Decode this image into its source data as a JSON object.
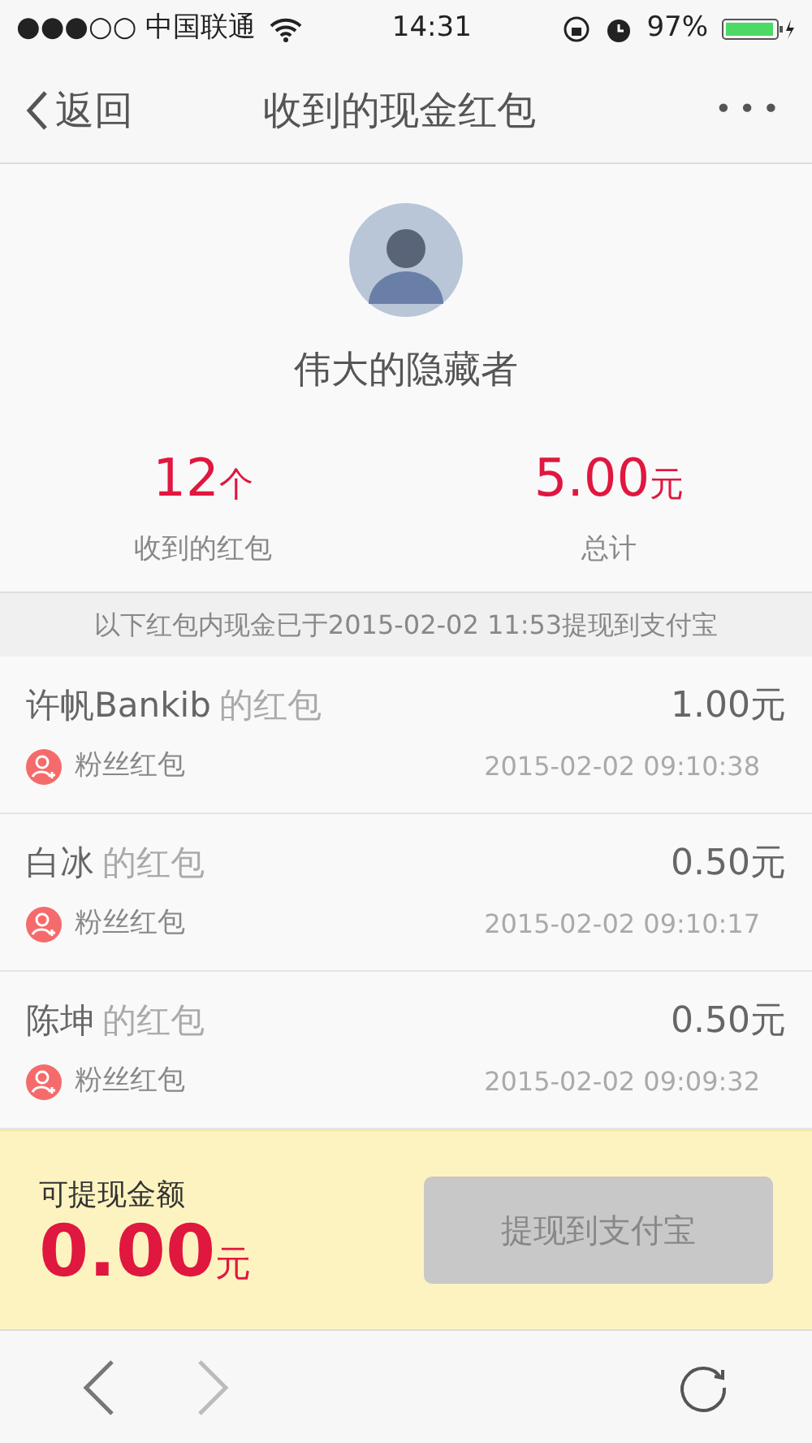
{
  "status_bar": {
    "carrier": "●●●○○ 中国联通",
    "time": "14:31",
    "battery": "97%"
  },
  "nav": {
    "back": "返回",
    "title": "收到的现金红包",
    "more": "•••"
  },
  "profile": {
    "name": "伟大的隐藏者",
    "stats": [
      {
        "value": "12",
        "unit": "个",
        "label": "收到的红包"
      },
      {
        "value": "5.00",
        "unit": "元",
        "label": "总计"
      }
    ]
  },
  "groups": [
    {
      "notice": "以下红包内现金已于2015-02-02 11:53提现到支付宝",
      "items": [
        {
          "sender": "许帆Bankib",
          "suffix": "的红包",
          "amount": "1.00元",
          "tag": "粉丝红包",
          "time": "2015-02-02 09:10:38"
        },
        {
          "sender": "白冰",
          "suffix": "的红包",
          "amount": "0.50元",
          "tag": "粉丝红包",
          "time": "2015-02-02 09:10:17"
        },
        {
          "sender": "陈坤",
          "suffix": "的红包",
          "amount": "0.50元",
          "tag": "粉丝红包",
          "time": "2015-02-02 09:09:32"
        }
      ]
    }
  ],
  "withdraw": {
    "label": "可提现金额",
    "value": "0.00",
    "unit": "元",
    "button": "提现到支付宝",
    "disabled": true
  }
}
